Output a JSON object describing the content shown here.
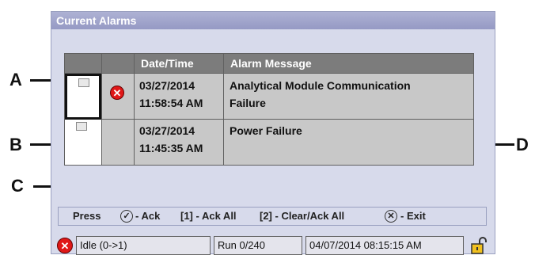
{
  "window": {
    "title": "Current Alarms"
  },
  "table": {
    "headers": {
      "ack": "",
      "state": "",
      "datetime": "Date/Time",
      "message": "Alarm Message"
    },
    "rows": [
      {
        "date": "03/27/2014",
        "time": "11:58:54 AM",
        "message_line1": "Analytical Module Communication",
        "message_line2": "Failure",
        "active": true
      },
      {
        "date": "03/27/2014",
        "time": "11:45:35 AM",
        "message_line1": "Power Failure",
        "message_line2": "",
        "active": false
      }
    ]
  },
  "callouts": {
    "a": "A",
    "b": "B",
    "c": "C",
    "d": "D"
  },
  "footer": {
    "press": "Press",
    "ack": "- Ack",
    "ack_all": "[1] - Ack All",
    "clear_ack_all": "[2] - Clear/Ack All",
    "exit": "- Exit"
  },
  "status_bar": {
    "mode": "Idle (0->1)",
    "run": "Run 0/240",
    "datetime": "04/07/2014 08:15:15 AM"
  },
  "colors": {
    "alarm_red": "#e01818",
    "title_bar": "#9599c4",
    "header_gray": "#7c7c7c"
  }
}
